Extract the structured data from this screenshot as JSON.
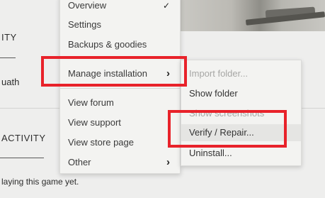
{
  "background": {
    "section_fragment_top": "ITY",
    "name_fragment": "uath",
    "section_fragment_bottom": "ACTIVITY",
    "footer_fragment": "laying this game yet."
  },
  "main_menu": {
    "items": [
      {
        "label": "Overview",
        "checked": true,
        "check_glyph": "✓"
      },
      {
        "label": "Settings"
      },
      {
        "label": "Backups & goodies"
      },
      {
        "label": "Manage installation",
        "submenu": true,
        "arrow_glyph": "›"
      },
      {
        "label": "View forum"
      },
      {
        "label": "View support"
      },
      {
        "label": "View store page"
      },
      {
        "label": "Other",
        "submenu": true,
        "arrow_glyph": "›"
      }
    ]
  },
  "submenu": {
    "items": [
      {
        "label": "Import folder...",
        "disabled": true
      },
      {
        "label": "Show folder",
        "disabled": false
      },
      {
        "label": "Show screenshots",
        "disabled": true
      },
      {
        "label": "Verify / Repair...",
        "disabled": false,
        "hovered": true
      },
      {
        "label": "Uninstall...",
        "disabled": false
      }
    ]
  },
  "annotations": {
    "color": "#e8222a"
  }
}
